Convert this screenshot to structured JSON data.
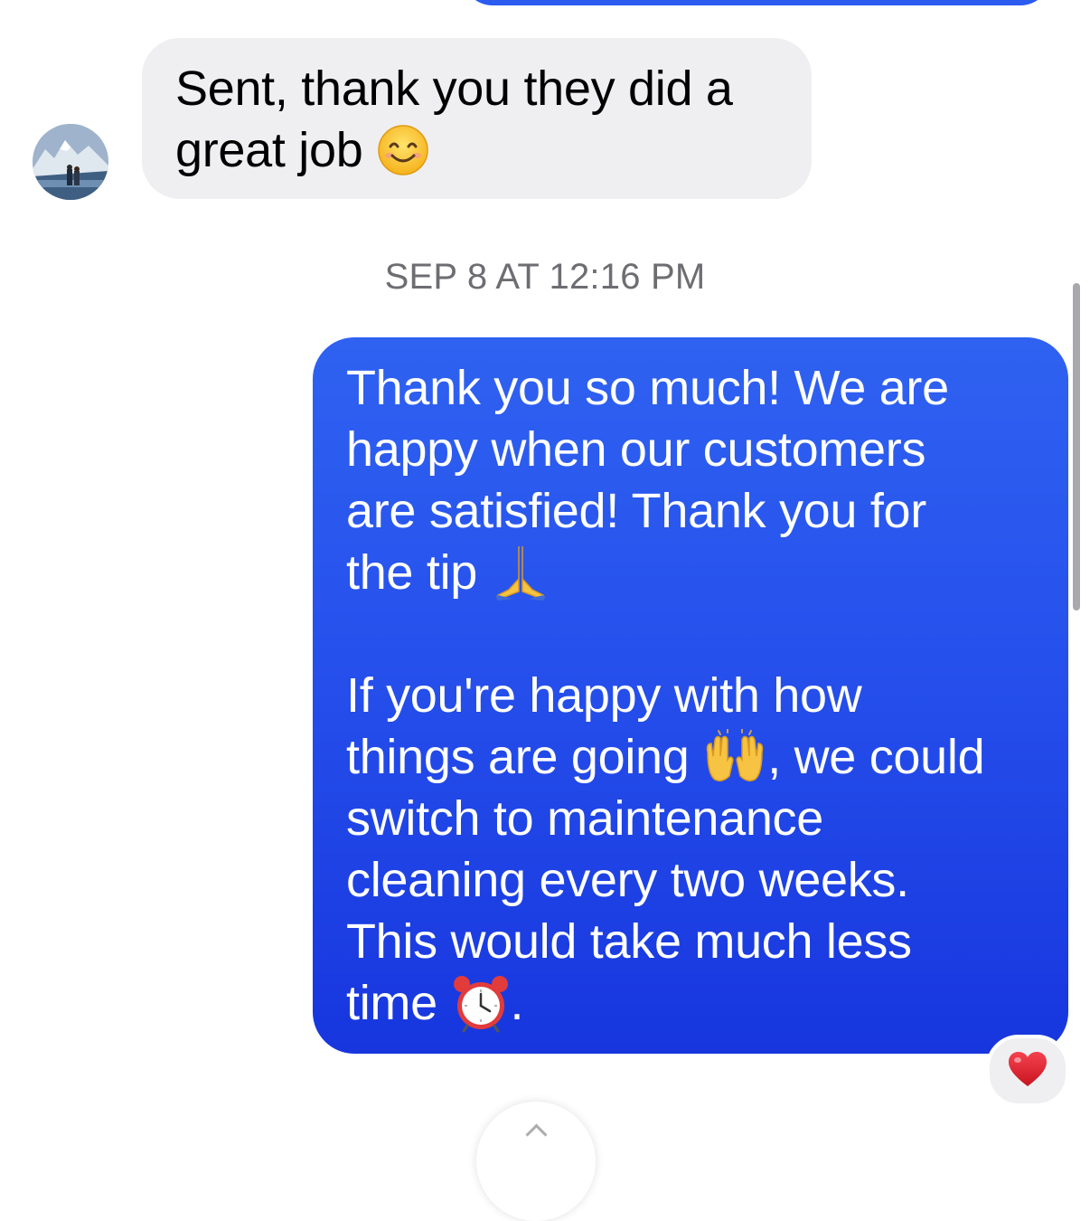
{
  "conversation": {
    "incoming_message": {
      "lines": [
        "Sent, thank you they did a",
        "great job"
      ],
      "emoji": "smiling-face-icon"
    },
    "timestamp": "SEP 8 AT 12:16 PM",
    "outgoing_message": {
      "paragraph1": {
        "line1": "Thank you so much! We are",
        "line2": "happy when our customers",
        "line3": "are satisfied! Thank you for",
        "line4": "the tip",
        "line4_emoji": "folded-hands-icon"
      },
      "paragraph2": {
        "line1": "If you're happy with how",
        "line2_a": "things are going",
        "line2_emoji": "raising-hands-icon",
        "line2_b": ", we could",
        "line3": "switch to maintenance",
        "line4": "cleaning every two weeks.",
        "line5": "This would take much less",
        "line6_a": "time",
        "line6_emoji": "alarm-clock-icon",
        "line6_b": "."
      }
    },
    "reaction": "heart-icon"
  },
  "colors": {
    "outgoing_bubble": "#2650ec",
    "incoming_bubble": "#efeff2",
    "timestamp_text": "#6d6d72",
    "reaction_heart": "#e3263a"
  }
}
